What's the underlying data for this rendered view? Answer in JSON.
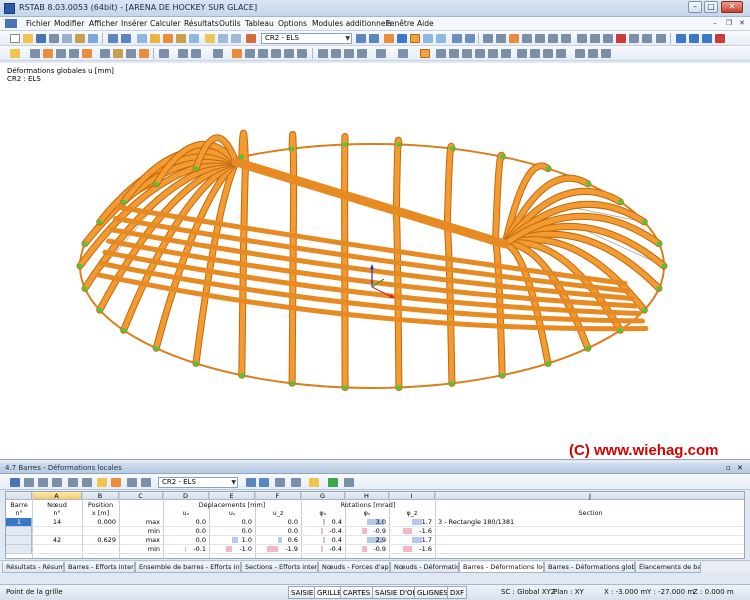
{
  "window": {
    "title": "RSTAB 8.03.0053 (64bit) - [ARENA DE HOCKEY SUR GLACE]"
  },
  "menu": [
    "Fichier",
    "Modifier",
    "Afficher",
    "Insérer",
    "Calculer",
    "Résultats",
    "Outils",
    "Tableau",
    "Options",
    "Modules additionnels",
    "Fenêtre",
    "Aide"
  ],
  "toolbar": {
    "load_combo": "CR2 - ELS"
  },
  "viewport": {
    "info_line1": "Déformations globales u [mm]",
    "info_line2": "CR2 : ELS",
    "watermark": "(C) www.wiehag.com"
  },
  "panel": {
    "title": "4.7 Barres - Déformations locales",
    "load_combo": "CR2 - ELS"
  },
  "table": {
    "columns": [
      "A",
      "B",
      "C",
      "D",
      "E",
      "F",
      "G",
      "H",
      "I",
      "J"
    ],
    "headers": {
      "barre": "Barre",
      "barre_sub": "n°",
      "noeud": "Nœud",
      "noeud_sub": "n°",
      "position": "Position",
      "position_sub": "x [m]",
      "deplacements": "Déplacements [mm]",
      "ux": "uₓ",
      "uy": "uᵧ",
      "uz": "u_z",
      "rotations": "Rotations [mrad]",
      "phix": "φₓ",
      "phiy": "φᵧ",
      "phiz": "φ_z",
      "section": "Section"
    },
    "rows": [
      {
        "barre": "1",
        "noeud": "14",
        "x": "0.000",
        "kind": "max",
        "ux": "0.0",
        "uy": "0.0",
        "uz": "0.0",
        "phix": "0.4",
        "phiy": "3.0",
        "phiz": "1.7",
        "section": "3 - Rectangle 180/1381"
      },
      {
        "barre": "",
        "noeud": "",
        "x": "",
        "kind": "min",
        "ux": "0.0",
        "uy": "0.0",
        "uz": "0.0",
        "phix": "-0.4",
        "phiy": "-0.9",
        "phiz": "-1.6",
        "section": ""
      },
      {
        "barre": "",
        "noeud": "42",
        "x": "0.629",
        "kind": "max",
        "ux": "0.0",
        "uy": "1.0",
        "uz": "0.6",
        "phix": "0.4",
        "phiy": "2.9",
        "phiz": "1.7",
        "section": ""
      },
      {
        "barre": "",
        "noeud": "",
        "x": "",
        "kind": "min",
        "ux": "-0.1",
        "uy": "-1.0",
        "uz": "-1.9",
        "phix": "-0.4",
        "phiy": "-0.9",
        "phiz": "-1.6",
        "section": ""
      }
    ]
  },
  "tabs": [
    "Résultats - Résumé",
    "Barres - Efforts internes",
    "Ensemble de barres - Efforts internes",
    "Sections - Efforts internes",
    "Nœuds - Forces d'appui",
    "Nœuds - Déformations",
    "Barres - Déformations locales",
    "Barres - Déformations globales",
    "Élancements de barre"
  ],
  "active_tab": "Barres - Déformations locales",
  "status": {
    "hint": "Point de la grille",
    "buttons": [
      "SAISIE",
      "GRILLE",
      "CARTES",
      "SAISIE D'OB",
      "GLIGNES",
      "DXF"
    ],
    "sc": "SC : Global XYZ",
    "plan": "Plan : XY",
    "x": "X : -3.000 m",
    "y": "Y : -27.000 m",
    "z": "Z : 0.000 m"
  },
  "colors": {
    "beam": "#f0952a",
    "beam_dark": "#c06a10",
    "support": "#3ccf3c",
    "brace": "#7a7a7a",
    "accent": "#3776c8"
  }
}
